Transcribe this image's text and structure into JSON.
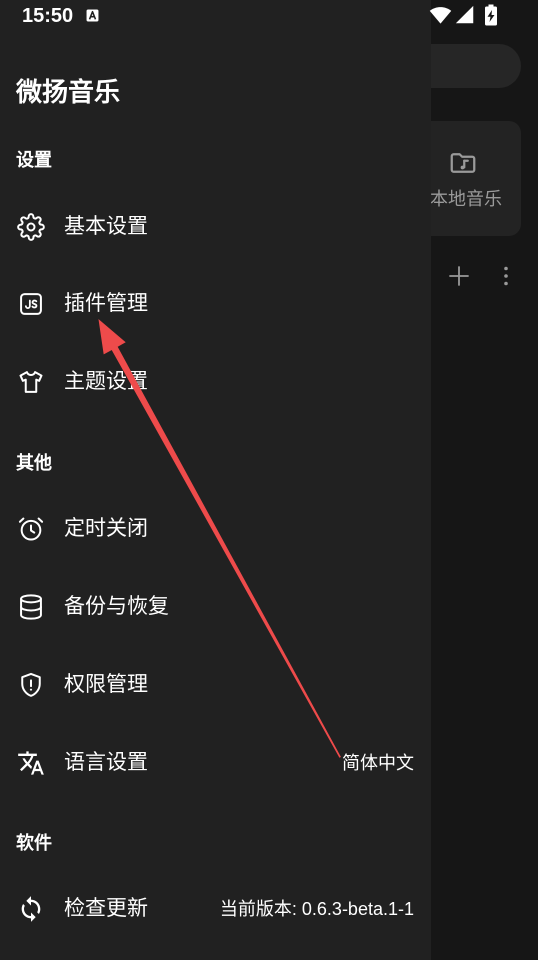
{
  "status_bar": {
    "time": "15:50",
    "notification_icon": "letter-a-icon",
    "icons": [
      "wifi-icon",
      "signal-icon",
      "battery-charging-icon"
    ]
  },
  "drawer": {
    "title": "微扬音乐",
    "sections": [
      {
        "header": "设置",
        "items": [
          {
            "icon": "gear-icon",
            "label": "基本设置"
          },
          {
            "icon": "js-plugin-icon",
            "label": "插件管理"
          },
          {
            "icon": "tshirt-icon",
            "label": "主题设置"
          }
        ]
      },
      {
        "header": "其他",
        "items": [
          {
            "icon": "alarm-icon",
            "label": "定时关闭"
          },
          {
            "icon": "database-icon",
            "label": "备份与恢复"
          },
          {
            "icon": "shield-alert-icon",
            "label": "权限管理"
          },
          {
            "icon": "translate-icon",
            "label": "语言设置",
            "value": "简体中文"
          }
        ]
      },
      {
        "header": "软件",
        "items": [
          {
            "icon": "sync-icon",
            "label": "检查更新",
            "value": "当前版本: 0.6.3-beta.1-1"
          }
        ]
      }
    ]
  },
  "background": {
    "card": {
      "icon": "folder-music-icon",
      "label": "本地音乐"
    },
    "actions": [
      {
        "icon": "plus-icon"
      },
      {
        "icon": "more-vertical-icon"
      }
    ]
  },
  "colors": {
    "drawer_background": "#212121",
    "app_background": "#161616",
    "surface": "#262626",
    "text_primary": "#ffffff",
    "text_secondary": "#9a9a9a",
    "annotation_red": "#ee4b4b"
  }
}
